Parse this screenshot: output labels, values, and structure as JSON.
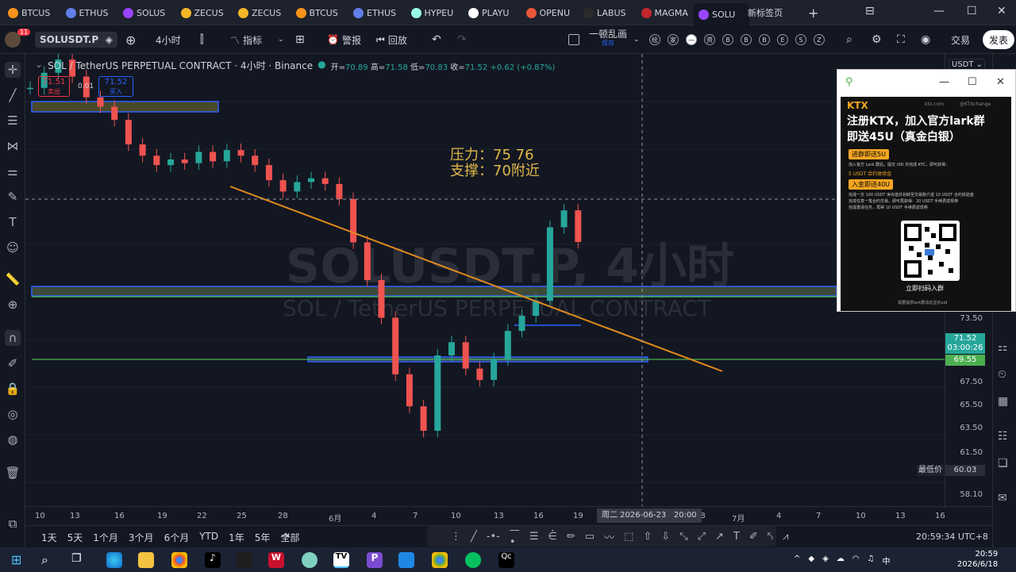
{
  "browser": {
    "tabs": [
      {
        "label": "BTCUS",
        "color": "#f7931a"
      },
      {
        "label": "ETHUS",
        "color": "#627eea"
      },
      {
        "label": "SOLUS",
        "color": "#9945ff"
      },
      {
        "label": "ZECUS",
        "color": "#f4b728"
      },
      {
        "label": "ZECUS",
        "color": "#f4b728"
      },
      {
        "label": "BTCUS",
        "color": "#f7931a"
      },
      {
        "label": "ETHUS",
        "color": "#627eea"
      },
      {
        "label": "HYPEU",
        "color": "#97fce4"
      },
      {
        "label": "PLAYU",
        "color": "#ffffff"
      },
      {
        "label": "OPENU",
        "color": "#e8563a"
      },
      {
        "label": "LABUS",
        "color": "#2b2b2b"
      },
      {
        "label": "MAGMA",
        "color": "#c1272d"
      },
      {
        "label": "SOLU",
        "color": "#9945ff"
      }
    ],
    "new_tab": "新标签页",
    "add_tab": "+"
  },
  "toolbar": {
    "badge": "11",
    "symbol": "SOLUSDT.P",
    "interval": "4小时",
    "indicators": "指标",
    "alert": "警报",
    "replay": "回放",
    "layout_name": "一顿乱画",
    "layout_status": "保存",
    "tools": [
      "绘",
      "家",
      "—",
      "资",
      "B",
      "B",
      "B",
      "E",
      "S",
      "Z"
    ],
    "trade": "交易",
    "publish": "发表"
  },
  "chart": {
    "title": "SOL / TetherUS PERPETUAL CONTRACT · 4小时 · Binance",
    "ohlc_open_label": "开=",
    "ohlc_open": "70.89",
    "ohlc_high_label": "高=",
    "ohlc_high": "71.58",
    "ohlc_low_label": "低=",
    "ohlc_low": "70.83",
    "ohlc_close_label": "收=",
    "ohlc_close": "71.52",
    "ohlc_change": "+0.62 (+0.87%)",
    "sell_price": "71.51",
    "sell_label": "卖出",
    "spread": "0.01",
    "buy_price": "71.52",
    "buy_label": "买入",
    "watermark_main": "SOLUSDT.P, 4小时",
    "watermark_sub": "SOL / TetherUS PERPETUAL CONTRACT",
    "note_resistance": "压力：75 76",
    "note_support": "支撑：70附近",
    "currency": "USDT",
    "crosshair_date": "周二 2026-06-23",
    "crosshair_time": "20:00"
  },
  "price_scale": {
    "labels": [
      "73.50",
      "67.50",
      "65.50",
      "63.50",
      "61.50",
      "58.10"
    ],
    "current_price": "71.52",
    "countdown": "03:00:26",
    "support_price": "69.55",
    "lowest_label": "最低价",
    "lowest_price": "60.03"
  },
  "time_scale": {
    "labels": [
      "10",
      "13",
      "16",
      "19",
      "22",
      "25",
      "28",
      "6月",
      "4",
      "7",
      "10",
      "13",
      "16",
      "19",
      "28",
      "7月",
      "4",
      "7",
      "10",
      "13",
      "16"
    ]
  },
  "bottom": {
    "ranges": [
      "1天",
      "5天",
      "1个月",
      "3个月",
      "6个月",
      "YTD",
      "1年",
      "5年",
      "全部"
    ],
    "clock": "20:59:34 UTC+8"
  },
  "popup_ad": {
    "brand": "KTX",
    "site": "ktx.com",
    "handle": "@KTXchange",
    "headline1": "注册KTX，加入官方lark群",
    "headline2": "即送45U（真金白银）",
    "btn1": "进群即送5U",
    "text1": "加入官方 Lark 群后，提交 UID 并完成 KYC，即可获得：",
    "text1b": "5 USDT 合约体验金",
    "btn2": "入金即送40U",
    "text2": "完成一次 100 USDT 净充值并划转至交易账户送 10 USDT 合约体验金",
    "text2b": "完成任意一笔合约交易，即可再获得：20 USDT 手续费返现券",
    "text2c": "完成邀请任务，再得 10 USDT 手续费返现券",
    "qr_caption": "立即扫码入群",
    "footer": "需要提供lark群消息显示uid"
  },
  "taskbar": {
    "time": "20:59",
    "date": "2026/6/18"
  },
  "colors": {
    "bg": "#131722",
    "up": "#26a69a",
    "down": "#ef5350",
    "trend": "#e08a1e",
    "zone_blue": "#2962ff",
    "support_green": "#4caf50",
    "note": "#e0b94a"
  },
  "chart_data": {
    "type": "candlestick",
    "ylim": [
      57.5,
      81.5
    ],
    "points": [
      {
        "x": "05-10",
        "y": 79.7
      },
      {
        "x": "05-11",
        "y": 80.5
      },
      {
        "x": "05-12",
        "y": 81.2
      },
      {
        "x": "05-13",
        "y": 80.3
      },
      {
        "x": "05-14",
        "y": 79.2
      },
      {
        "x": "05-15",
        "y": 78.7
      },
      {
        "x": "05-16",
        "y": 78.0
      },
      {
        "x": "05-17",
        "y": 76.7
      },
      {
        "x": "05-18",
        "y": 76.1
      },
      {
        "x": "05-19",
        "y": 75.6
      },
      {
        "x": "05-20",
        "y": 75.9
      },
      {
        "x": "05-21",
        "y": 75.7
      },
      {
        "x": "05-22",
        "y": 76.3
      },
      {
        "x": "05-23",
        "y": 75.8
      },
      {
        "x": "05-24",
        "y": 76.4
      },
      {
        "x": "05-25",
        "y": 76.1
      },
      {
        "x": "05-26",
        "y": 75.6
      },
      {
        "x": "05-27",
        "y": 74.8
      },
      {
        "x": "05-28",
        "y": 74.2
      },
      {
        "x": "05-29",
        "y": 74.7
      },
      {
        "x": "05-30",
        "y": 74.9
      },
      {
        "x": "05-31",
        "y": 74.6
      },
      {
        "x": "06-01",
        "y": 73.8
      },
      {
        "x": "06-02",
        "y": 71.5
      },
      {
        "x": "06-03",
        "y": 69.5
      },
      {
        "x": "06-04",
        "y": 67.5
      },
      {
        "x": "06-05",
        "y": 64.5
      },
      {
        "x": "06-06",
        "y": 62.8
      },
      {
        "x": "06-07",
        "y": 61.5
      },
      {
        "x": "06-08",
        "y": 65.5
      },
      {
        "x": "06-09",
        "y": 66.2
      },
      {
        "x": "06-10",
        "y": 64.8
      },
      {
        "x": "06-11",
        "y": 64.2
      },
      {
        "x": "06-12",
        "y": 65.3
      },
      {
        "x": "06-13",
        "y": 66.8
      },
      {
        "x": "06-14",
        "y": 67.6
      },
      {
        "x": "06-15",
        "y": 68.4
      },
      {
        "x": "06-16",
        "y": 72.3
      },
      {
        "x": "06-17",
        "y": 73.2
      },
      {
        "x": "06-18",
        "y": 71.52
      }
    ]
  }
}
